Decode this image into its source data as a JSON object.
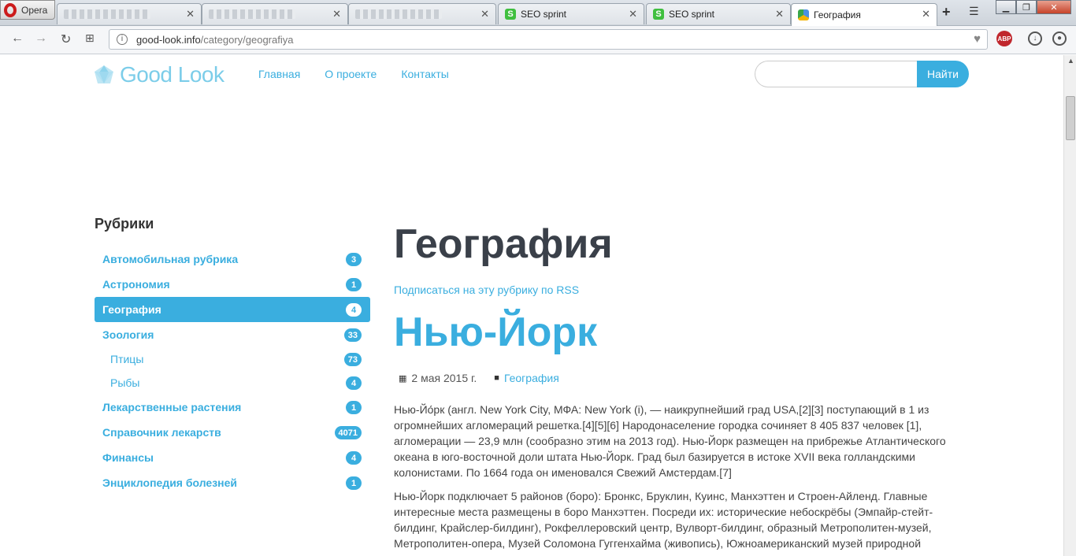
{
  "browser": {
    "opera_label": "Opera",
    "tabs": [
      {
        "title": "",
        "blurred": true
      },
      {
        "title": "",
        "blurred": true
      },
      {
        "title": "",
        "blurred": true
      },
      {
        "title": "SEO sprint",
        "icon": "seo-sprint-icon"
      },
      {
        "title": "SEO sprint",
        "icon": "seo-sprint-icon"
      },
      {
        "title": "География",
        "icon": "site-favicon"
      }
    ],
    "url_host": "good-look.info",
    "url_path": "/category/geografiya",
    "abp_label": "ABP"
  },
  "site": {
    "logo_text": "Good Look",
    "nav": [
      "Главная",
      "О проекте",
      "Контакты"
    ],
    "search_button": "Найти",
    "search_placeholder": "",
    "accent_color": "#3aaedf"
  },
  "sidebar": {
    "title": "Рубрики",
    "categories": [
      {
        "label": "Автомобильная рубрика",
        "count": "3"
      },
      {
        "label": "Астрономия",
        "count": "1"
      },
      {
        "label": "География",
        "count": "4",
        "active": true
      },
      {
        "label": "Зоология",
        "count": "33"
      },
      {
        "label": "Птицы",
        "count": "73",
        "sub": true
      },
      {
        "label": "Рыбы",
        "count": "4",
        "sub": true
      },
      {
        "label": "Лекарственные растения",
        "count": "1"
      },
      {
        "label": "Справочник лекарств",
        "count": "4071"
      },
      {
        "label": "Финансы",
        "count": "4"
      },
      {
        "label": "Энциклопедия болезней",
        "count": "1"
      }
    ]
  },
  "content": {
    "page_title": "География",
    "rss_link": "Подписаться на эту рубрику по RSS",
    "post_title": "Нью-Йорк",
    "date": "2 мая 2015 г.",
    "category": "География",
    "paragraphs": [
      "Нью-Йо́рк (англ. New York City, МФА: New York (i), — наикрупнейший град USA,[2][3] поступающий в 1 из огромнейших агломераций решетка.[4][5][6] Народонаселение городка сочиняет 8 405 837 человек [1], агломерации — 23,9 млн (сообразно этим на 2013 год). Нью-Йорк размещен на прибрежье Атлантического океана в юго-восточной доли штата Нью-Йорк. Град был базируется в истоке XVII века голландскими колонистами. По 1664 года он именовался Свежий Амстердам.[7]",
      "Нью-Йорк подключает 5 районов (боро): Бронкс, Бруклин, Куинс, Манхэттен и Строен-Айленд. Главные интересные места размещены в боро Манхэттен. Посреди их: исторические небоскрёбы (Эмпайр-стейт-билдинг, Крайслер-билдинг), Рокфеллеровский центр, Вулворт-билдинг, образный Метрополитен-музей, Метрополитен-опера, Музей Соломона Гуггенхайма (живопись), Южноамериканский музей природной"
    ]
  }
}
